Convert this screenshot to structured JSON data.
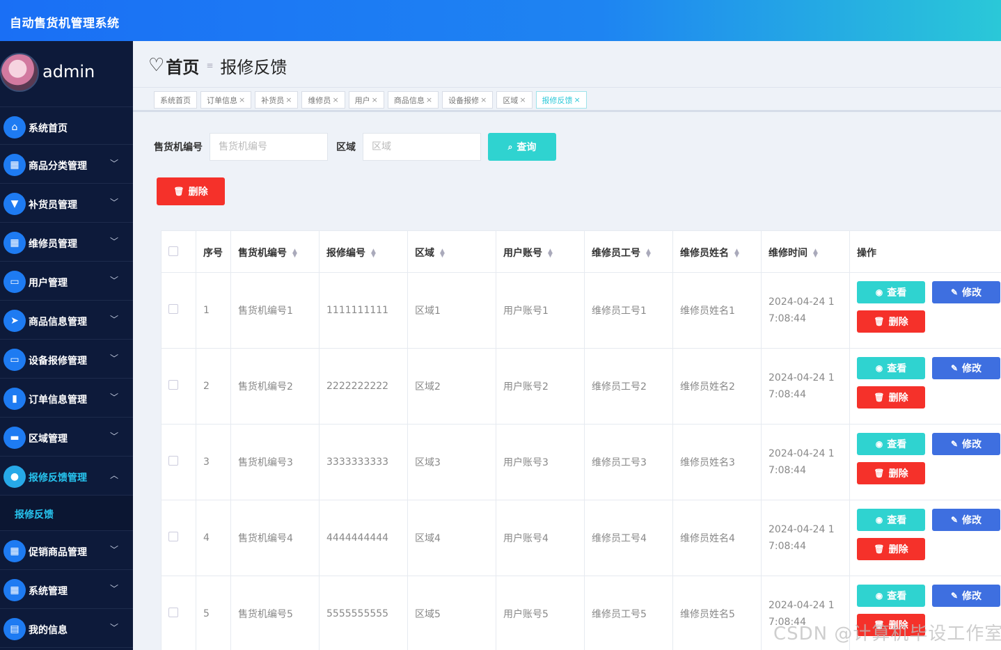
{
  "app": {
    "title": "自动售货机管理系统"
  },
  "user": {
    "name": "admin"
  },
  "sidebar": {
    "items": [
      {
        "label": "系统首页",
        "icon": "home-icon",
        "expandable": false
      },
      {
        "label": "商品分类管理",
        "icon": "grid-icon",
        "expandable": true
      },
      {
        "label": "补货员管理",
        "icon": "brush-icon",
        "expandable": true
      },
      {
        "label": "维修员管理",
        "icon": "grid-icon",
        "expandable": true
      },
      {
        "label": "用户管理",
        "icon": "chat-icon",
        "expandable": true
      },
      {
        "label": "商品信息管理",
        "icon": "send-icon",
        "expandable": true
      },
      {
        "label": "设备报修管理",
        "icon": "monitor-icon",
        "expandable": true
      },
      {
        "label": "订单信息管理",
        "icon": "chart-icon",
        "expandable": true
      },
      {
        "label": "区域管理",
        "icon": "briefcase-icon",
        "expandable": true
      },
      {
        "label": "报修反馈管理",
        "icon": "bulb-icon",
        "expandable": true,
        "active": true,
        "submenu": [
          "报修反馈"
        ]
      },
      {
        "label": "促销商品管理",
        "icon": "grid-icon",
        "expandable": true
      },
      {
        "label": "系统管理",
        "icon": "grid-icon",
        "expandable": true
      },
      {
        "label": "我的信息",
        "icon": "card-icon",
        "expandable": true
      }
    ]
  },
  "breadcrumb": {
    "home": "首页",
    "separator": "≡",
    "current": "报修反馈"
  },
  "tabs": [
    {
      "label": "系统首页",
      "closable": false
    },
    {
      "label": "订单信息",
      "closable": true
    },
    {
      "label": "补货员",
      "closable": true
    },
    {
      "label": "维修员",
      "closable": true
    },
    {
      "label": "用户",
      "closable": true
    },
    {
      "label": "商品信息",
      "closable": true
    },
    {
      "label": "设备报修",
      "closable": true
    },
    {
      "label": "区域",
      "closable": true
    },
    {
      "label": "报修反馈",
      "closable": true,
      "active": true
    }
  ],
  "search": {
    "machine_label": "售货机编号",
    "machine_placeholder": "售货机编号",
    "area_label": "区域",
    "area_placeholder": "区域",
    "query_button": "查询"
  },
  "toolbar": {
    "delete_button": "删除"
  },
  "table": {
    "columns": [
      "序号",
      "售货机编号",
      "报修编号",
      "区域",
      "用户账号",
      "维修员工号",
      "维修员姓名",
      "维修时间",
      "操作"
    ],
    "sortable": [
      false,
      true,
      true,
      true,
      true,
      true,
      true,
      true,
      false
    ],
    "rows": [
      {
        "index": "1",
        "machine": "售货机编号1",
        "repair_no": "1111111111",
        "area": "区域1",
        "account": "用户账号1",
        "worker_no": "维修员工号1",
        "worker_name": "维修员姓名1",
        "time": "2024-04-24 17:08:44"
      },
      {
        "index": "2",
        "machine": "售货机编号2",
        "repair_no": "2222222222",
        "area": "区域2",
        "account": "用户账号2",
        "worker_no": "维修员工号2",
        "worker_name": "维修员姓名2",
        "time": "2024-04-24 17:08:44"
      },
      {
        "index": "3",
        "machine": "售货机编号3",
        "repair_no": "3333333333",
        "area": "区域3",
        "account": "用户账号3",
        "worker_no": "维修员工号3",
        "worker_name": "维修员姓名3",
        "time": "2024-04-24 17:08:44"
      },
      {
        "index": "4",
        "machine": "售货机编号4",
        "repair_no": "4444444444",
        "area": "区域4",
        "account": "用户账号4",
        "worker_no": "维修员工号4",
        "worker_name": "维修员姓名4",
        "time": "2024-04-24 17:08:44"
      },
      {
        "index": "5",
        "machine": "售货机编号5",
        "repair_no": "5555555555",
        "area": "区域5",
        "account": "用户账号5",
        "worker_no": "维修员工号5",
        "worker_name": "维修员姓名5",
        "time": "2024-04-24 17:08:44"
      }
    ],
    "actions": {
      "view": "查看",
      "edit": "修改",
      "delete": "删除"
    }
  },
  "watermark": "CSDN @计算机毕设工作室",
  "colors": {
    "sidebar_bg": "#0d1a3a",
    "accent_blue": "#1e7bf2",
    "accent_cyan": "#2fd3d0",
    "danger": "#f5312a",
    "edit": "#3e6fe0"
  }
}
